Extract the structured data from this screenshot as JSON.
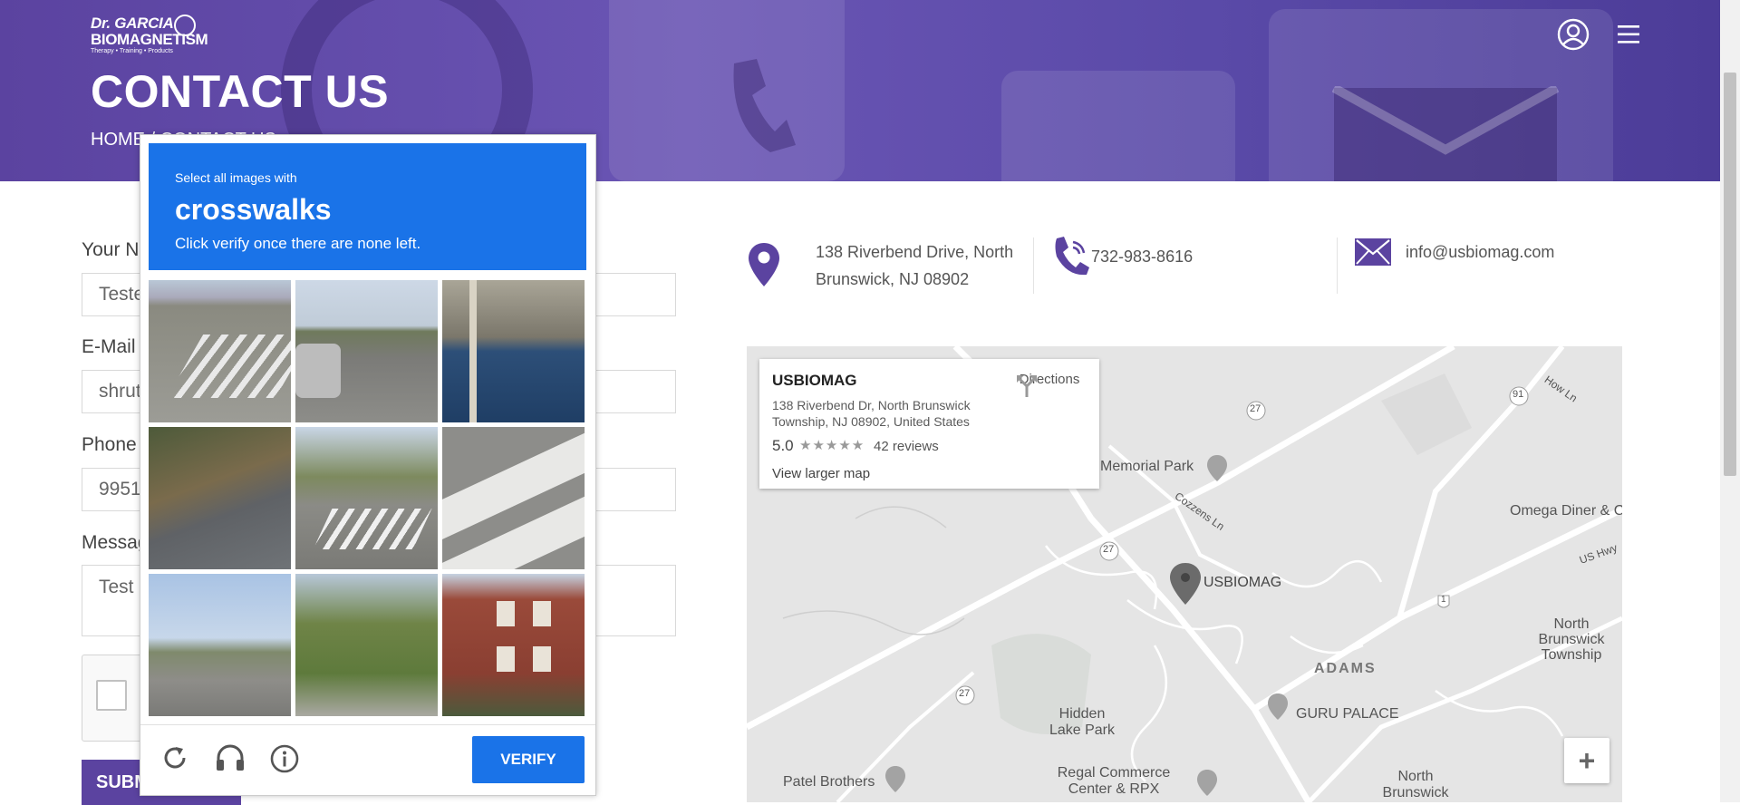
{
  "header": {
    "logo_line1": "Dr. GARCIA",
    "logo_line2": "BIOMAGNETISM",
    "logo_tagline": "Therapy • Training • Products",
    "title": "CONTACT US",
    "breadcrumb": "HOME / CONTACT US"
  },
  "form": {
    "name_label": "Your Name",
    "name_value": "Tester",
    "email_label": "E-Mail",
    "email_value": "shruti",
    "phone_label": "Phone",
    "phone_value": "9951",
    "message_label": "Message",
    "message_value": "Test",
    "submit_label": "SUBMIT"
  },
  "contact": {
    "address_line1": "138 Riverbend Drive, North",
    "address_line2": "Brunswick, NJ 08902",
    "phone": "732-983-8616",
    "email": "info@usbiomag.com",
    "accent_color": "#5b43a0"
  },
  "map": {
    "card_name": "USBIOMAG",
    "card_address": "138 Riverbend Dr, North Brunswick Township, NJ 08902, United States",
    "rating": "5.0",
    "stars": "★★★★★",
    "reviews": "42 reviews",
    "larger_map": "View larger map",
    "directions": "Directions",
    "zoom_in": "+",
    "labels": {
      "memorial_park": "Memorial Park",
      "cozzens_ln": "Cozzens Ln",
      "usbiomag": "USBIOMAG",
      "omega_diner": "Omega Diner & Cafe",
      "us_hwy": "US Hwy",
      "how_ln": "How Ln",
      "north_brunswick_twp": "North Brunswick Township",
      "adams": "ADAMS",
      "guru_palace": "GURU PALACE",
      "hidden_lake_park": "Hidden Lake Park",
      "patel_brothers": "Patel Brothers",
      "regal_commerce": "Regal Commerce Center & RPX",
      "north_brunswick": "North Brunswick",
      "route_27a": "27",
      "route_27b": "27",
      "route_27c": "27",
      "route_91": "91",
      "route_1": "1"
    }
  },
  "captcha": {
    "prompt_small": "Select all images with",
    "prompt_target": "crosswalks",
    "prompt_instruction": "Click verify once there are none left.",
    "verify_label": "VERIFY",
    "brand_color": "#1a73e8",
    "icons": [
      "reload-icon",
      "audio-headphones-icon",
      "info-icon"
    ],
    "tiles": [
      "crosswalk-road-corner",
      "residential-street-cars",
      "waterfront-stairs",
      "highway-grass-shoulder",
      "intersection-crosswalk",
      "crosswalk-closeup",
      "highway-traffic",
      "street-trees",
      "brick-building-traffic-light"
    ]
  }
}
